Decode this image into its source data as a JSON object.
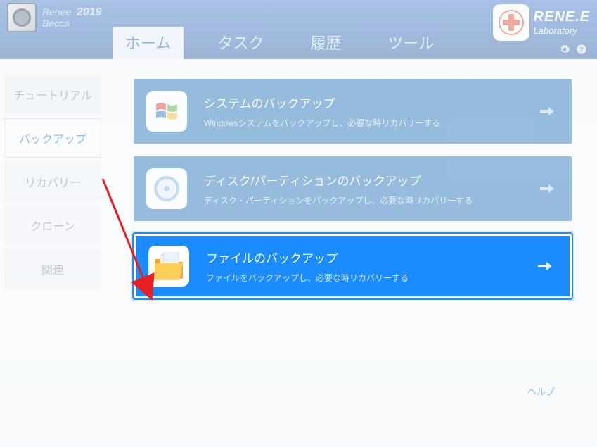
{
  "app": {
    "name1": "Renee",
    "name2": "Becca",
    "year": "2019"
  },
  "brand": {
    "line1": "RENE.E",
    "line2": "Laboratory"
  },
  "tabs": {
    "home": "ホーム",
    "task": "タスク",
    "history": "履歴",
    "tool": "ツール"
  },
  "sidebar": {
    "tutorial": "チュートリアル",
    "backup": "バックアップ",
    "recovery": "リカバリー",
    "clone": "クローン",
    "related": "関連"
  },
  "cards": {
    "system": {
      "title": "システムのバックアップ",
      "desc": "Windowsシステムをバックアップし、必要な時リカバリーする"
    },
    "disk": {
      "title": "ディスク/パーティションのバックアップ",
      "desc": "ディスク・パーティションをバックアップし、必要な時リカバリーする"
    },
    "file": {
      "title": "ファイルのバックアップ",
      "desc": "ファイルをバックアップし、必要な時リカバリーする"
    }
  },
  "footer": {
    "help": "ヘルプ"
  }
}
